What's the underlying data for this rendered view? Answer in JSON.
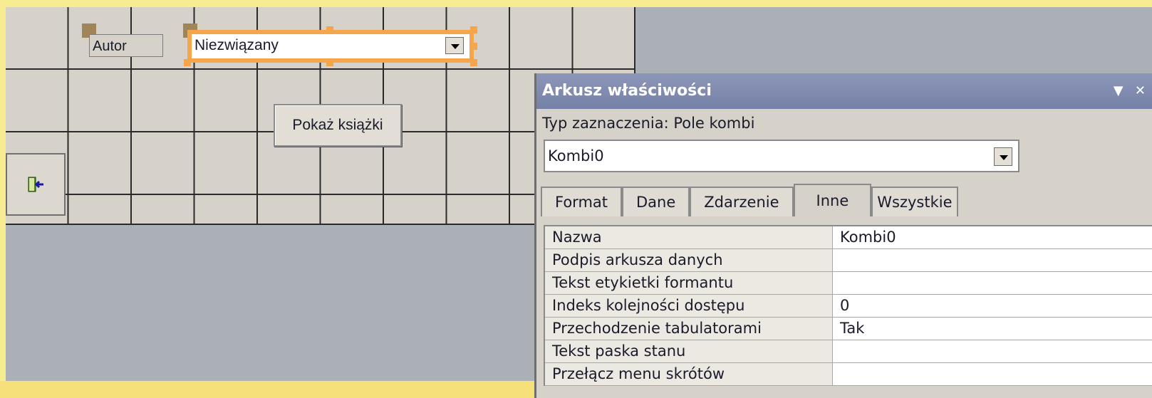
{
  "form": {
    "author_label": "Autor",
    "combo_value": "Niezwiązany",
    "show_books_button": "Pokaż książki"
  },
  "props": {
    "title": "Arkusz właściwości",
    "title_menu_glyph": "▼",
    "title_close_glyph": "✕",
    "selection_type": "Typ zaznaczenia:  Pole kombi",
    "object_select": "Kombi0",
    "tabs": [
      "Format",
      "Dane",
      "Zdarzenie",
      "Inne",
      "Wszystkie"
    ],
    "rows": [
      {
        "name": "Nazwa",
        "value": "Kombi0"
      },
      {
        "name": "Podpis arkusza danych",
        "value": ""
      },
      {
        "name": "Tekst etykietki formantu",
        "value": ""
      },
      {
        "name": "Indeks kolejności dostępu",
        "value": "0"
      },
      {
        "name": "Przechodzenie tabulatorami",
        "value": "Tak"
      },
      {
        "name": "Tekst paska stanu",
        "value": ""
      },
      {
        "name": "Przełącz menu skrótów",
        "value": ""
      }
    ]
  },
  "colors": {
    "selection_orange": "#f5a64a",
    "titlebar": "#7e88ad",
    "slide_background": "#f8ec93"
  },
  "icons": {
    "exit": "exit-door-icon"
  }
}
